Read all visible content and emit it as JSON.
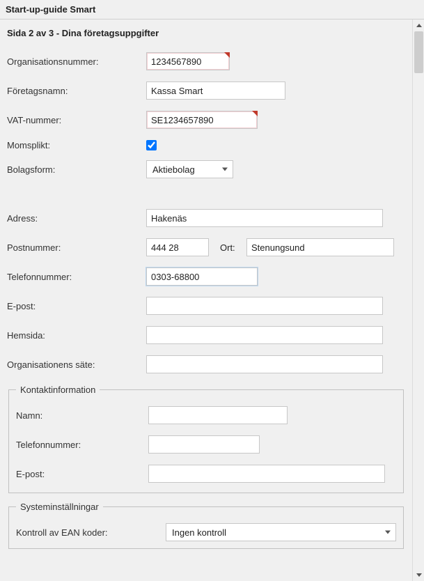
{
  "window_title": "Start-up-guide Smart",
  "page_heading": "Sida 2 av 3 - Dina företagsuppgifter",
  "labels": {
    "org_number": "Organisationsnummer:",
    "company_name": "Företagsnamn:",
    "vat": "VAT-nummer:",
    "momsplikt": "Momsplikt:",
    "bolagsform": "Bolagsform:",
    "adress": "Adress:",
    "postnummer": "Postnummer:",
    "ort": "Ort:",
    "telefon": "Telefonnummer:",
    "epost": "E-post:",
    "hemsida": "Hemsida:",
    "org_sate": "Organisationens säte:",
    "contact_legend": "Kontaktinformation",
    "contact_name": "Namn:",
    "contact_phone": "Telefonnummer:",
    "contact_email": "E-post:",
    "system_legend": "Systeminställningar",
    "ean_control": "Kontroll av EAN koder:"
  },
  "values": {
    "org_number": "1234567890",
    "company_name": "Kassa Smart",
    "vat": "SE1234657890",
    "momsplikt_checked": true,
    "bolagsform_selected": "Aktiebolag",
    "adress": "Hakenäs",
    "postnummer": "444 28",
    "ort": "Stenungsund",
    "telefon": "0303-68800",
    "epost": "",
    "hemsida": "",
    "org_sate": "",
    "contact_name": "",
    "contact_phone": "",
    "contact_email": "",
    "ean_selected": "Ingen kontroll"
  }
}
